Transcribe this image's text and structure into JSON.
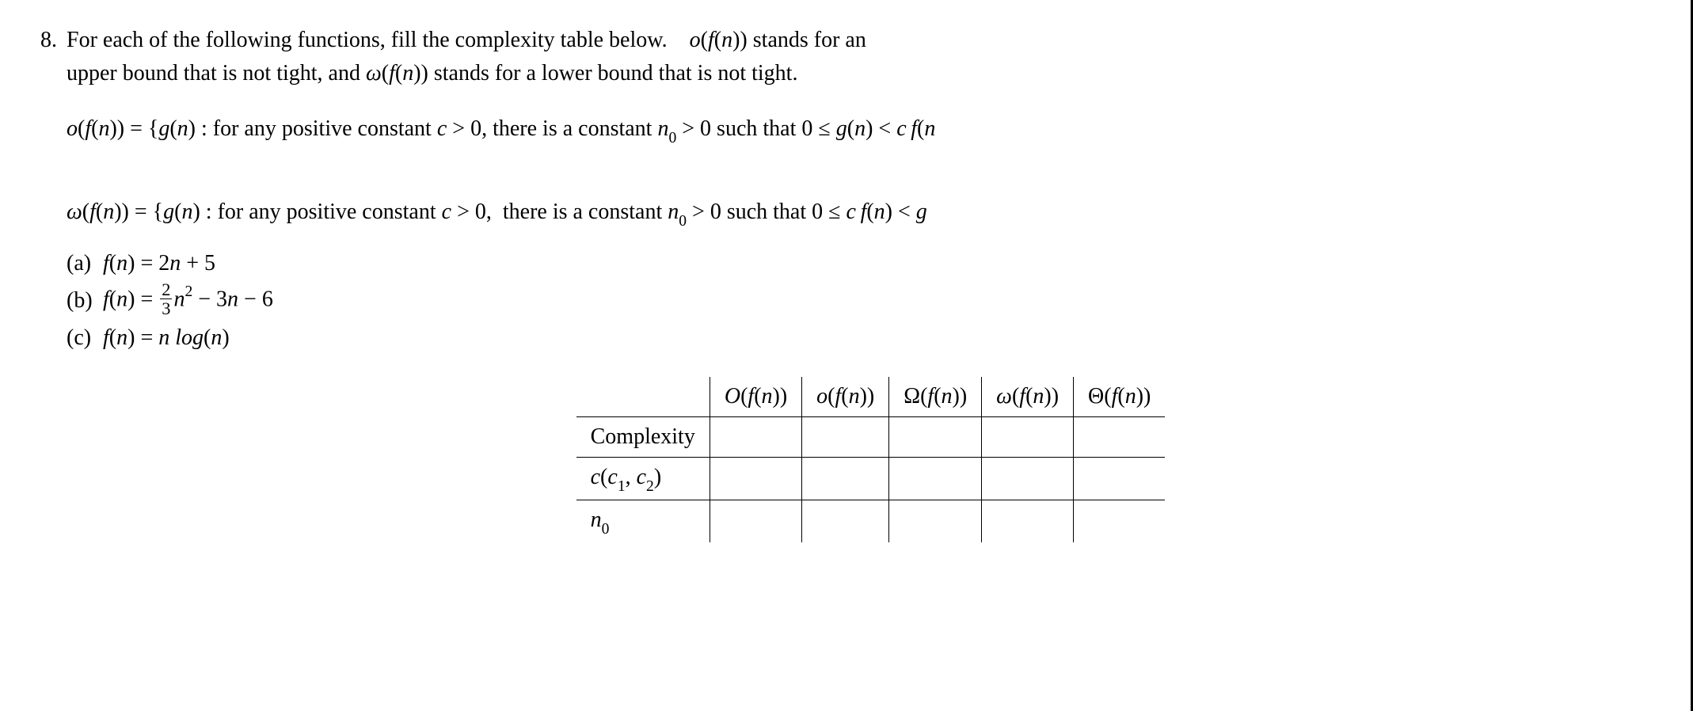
{
  "problem": {
    "number": "8.",
    "intro_part1": "For each of the following functions, fill the complexity table below.",
    "intro_math1_o": "o",
    "intro_math1_f": "f",
    "intro_math1_n": "n",
    "intro_part2": "stands for an",
    "intro_part3": "upper bound that is not tight, and",
    "intro_math2_w": "ω",
    "intro_math2_f": "f",
    "intro_math2_n": "n",
    "intro_part4": "stands for a lower bound that is not tight."
  },
  "defs": {
    "o": {
      "lhs_o": "o",
      "lhs_f": "f",
      "lhs_n": "n",
      "eq": "=",
      "lb": "{",
      "g": "g",
      "gn": "n",
      "colon": ":",
      "text": "for   any   positive   constant",
      "c": "c",
      "gt": ">",
      "zero": "0",
      "comma": ",",
      "text2": "there is a constant",
      "n0_n": "n",
      "n0_0": "0",
      "gt2": ">",
      "zero2": "0",
      "text3": "such that",
      "zero3": "0",
      "le": "≤",
      "g2": "g",
      "gn2": "n",
      "lt": "<",
      "c2": "c",
      "f2": "f",
      "n2": "n"
    },
    "w": {
      "lhs_w": "ω",
      "lhs_f": "f",
      "lhs_n": "n",
      "eq": "=",
      "lb": "{",
      "g": "g",
      "gn": "n",
      "colon": ":",
      "text": "for   any   positive   constant",
      "c": "c",
      "gt": ">",
      "zero": "0",
      "comma": ",",
      "text2": "there  is a constant",
      "n0_n": "n",
      "n0_0": "0",
      "gt2": ">",
      "zero2": "0",
      "text3": "such that",
      "zero3": "0",
      "le": "≤",
      "c2": "c",
      "f2": "f",
      "n2": "n",
      "lt": "<",
      "g2": "g"
    }
  },
  "items": {
    "a": {
      "label": "(a)",
      "f": "f",
      "n": "n",
      "eq": "=",
      "expr_2": "2",
      "expr_n": "n",
      "expr_plus": "+",
      "expr_5": "5"
    },
    "b": {
      "label": "(b)",
      "f": "f",
      "n": "n",
      "eq": "=",
      "frac_num": "2",
      "frac_den": "3",
      "n2": "n",
      "sq": "2",
      "minus1": "−",
      "three": "3",
      "n3": "n",
      "minus2": "−",
      "six": "6"
    },
    "c": {
      "label": "(c)",
      "f": "f",
      "n": "n",
      "eq": "=",
      "n1": "n",
      "log": "log",
      "n2": "n"
    }
  },
  "table": {
    "headers": {
      "h1_O": "O",
      "h1_f": "f",
      "h1_n": "n",
      "h2_o": "o",
      "h2_f": "f",
      "h2_n": "n",
      "h3_Om": "Ω",
      "h3_f": "f",
      "h3_n": "n",
      "h4_w": "ω",
      "h4_f": "f",
      "h4_n": "n",
      "h5_Th": "Θ",
      "h5_f": "f",
      "h5_n": "n"
    },
    "rows": {
      "r1": "Complexity",
      "r2_c": "c",
      "r2_c1": "c",
      "r2_1": "1",
      "r2_c2": "c",
      "r2_2": "2",
      "r3_n": "n",
      "r3_0": "0"
    },
    "cells": {
      "r1c1": "",
      "r1c2": "",
      "r1c3": "",
      "r1c4": "",
      "r1c5": "",
      "r2c1": "",
      "r2c2": "",
      "r2c3": "",
      "r2c4": "",
      "r2c5": "",
      "r3c1": "",
      "r3c2": "",
      "r3c3": "",
      "r3c4": "",
      "r3c5": ""
    }
  }
}
